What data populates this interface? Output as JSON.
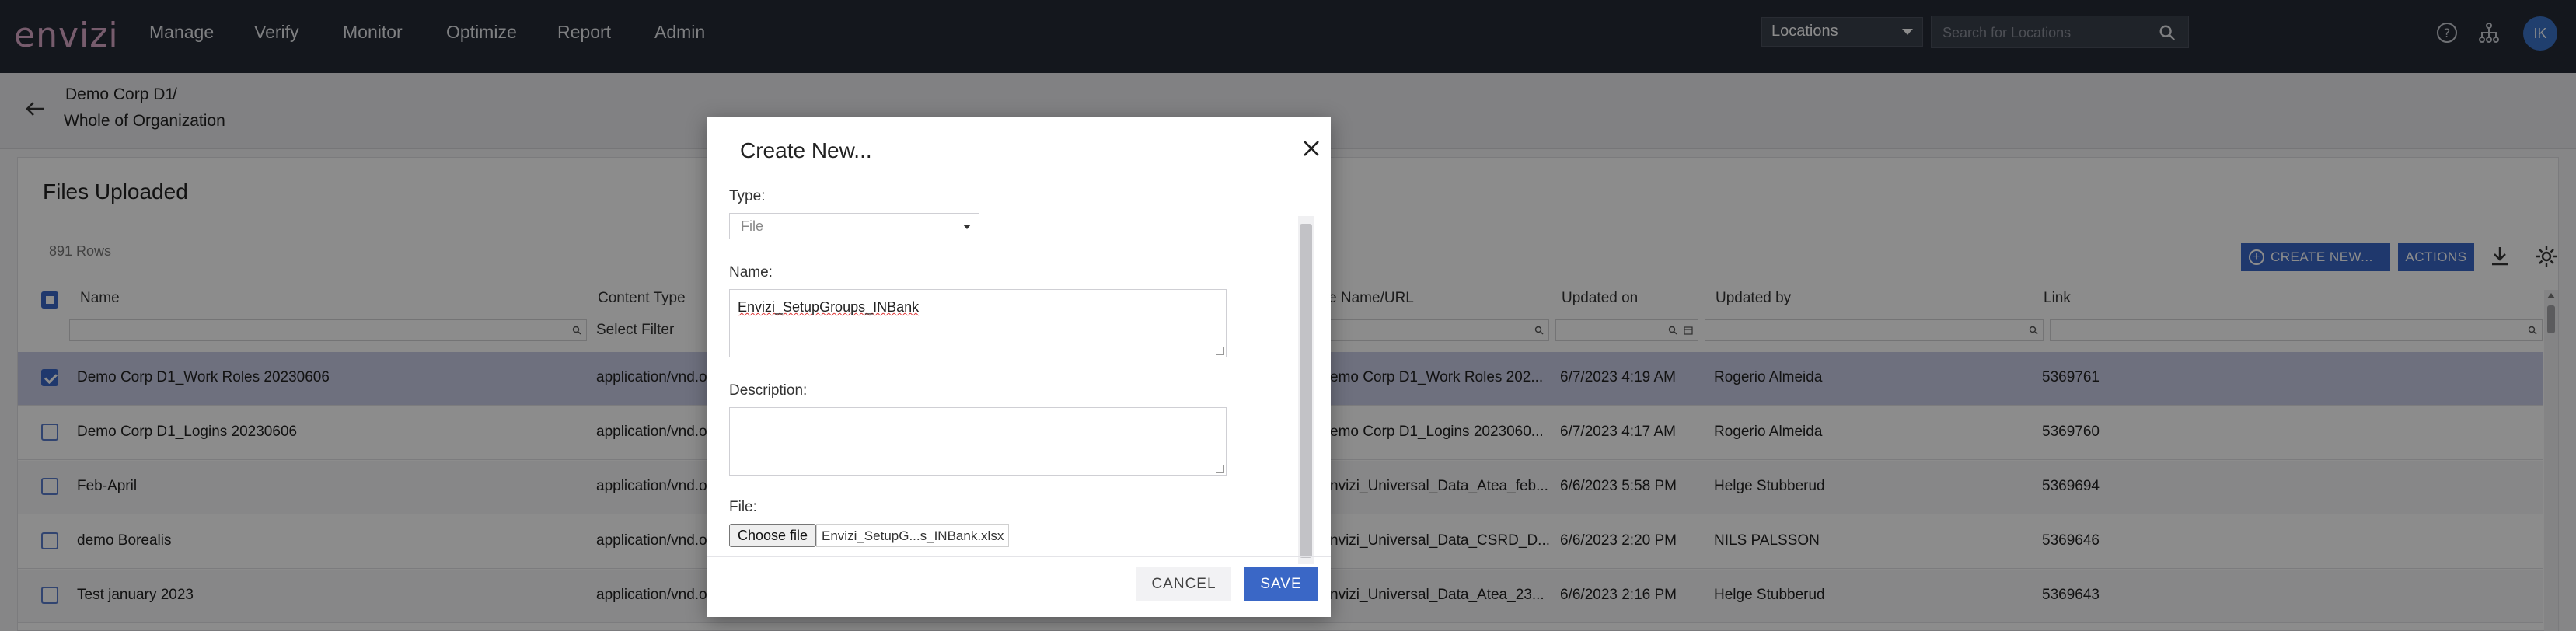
{
  "app": {
    "logo": "envizi"
  },
  "nav": {
    "items": [
      "Manage",
      "Verify",
      "Monitor",
      "Optimize",
      "Report",
      "Admin"
    ]
  },
  "locations": {
    "selected": "Locations",
    "search_placeholder": "Search for Locations"
  },
  "user": {
    "initials": "IK"
  },
  "breadcrumb": {
    "parent": "Demo Corp D1",
    "separator": "/",
    "current": "Whole of Organization"
  },
  "panel": {
    "title": "Files Uploaded",
    "row_count": "891 Rows",
    "create_label": "CREATE NEW...",
    "actions_label": "ACTIONS"
  },
  "table": {
    "columns": [
      "Name",
      "Content Type",
      "File Name/URL",
      "Updated on",
      "Updated by",
      "Link"
    ],
    "content_type_filter": "Select Filter",
    "rows": [
      {
        "name": "Demo Corp D1_Work Roles 20230606",
        "content_type": "application/vnd.op",
        "file": "emo Corp D1_Work Roles 202...",
        "updated_on": "6/7/2023 4:19 AM",
        "updated_by": "Rogerio Almeida",
        "link": "5369761",
        "checked": true
      },
      {
        "name": "Demo Corp D1_Logins 20230606",
        "content_type": "application/vnd.op",
        "file": "emo Corp D1_Logins 2023060...",
        "updated_on": "6/7/2023 4:17 AM",
        "updated_by": "Rogerio Almeida",
        "link": "5369760",
        "checked": false
      },
      {
        "name": "Feb-April",
        "content_type": "application/vnd.op",
        "file": "nvizi_Universal_Data_Atea_feb...",
        "updated_on": "6/6/2023 5:58 PM",
        "updated_by": "Helge Stubberud",
        "link": "5369694",
        "checked": false
      },
      {
        "name": "demo Borealis",
        "content_type": "application/vnd.op",
        "file": "nvizi_Universal_Data_CSRD_D...",
        "updated_on": "6/6/2023 2:20 PM",
        "updated_by": "NILS PALSSON",
        "link": "5369646",
        "checked": false
      },
      {
        "name": "Test january 2023",
        "content_type": "application/vnd.op",
        "file": "nvizi_Universal_Data_Atea_23...",
        "updated_on": "6/6/2023 2:16 PM",
        "updated_by": "Helge Stubberud",
        "link": "5369643",
        "checked": false
      }
    ]
  },
  "dialog": {
    "title": "Create New...",
    "type_label": "Type:",
    "type_value": "File",
    "name_label": "Name:",
    "name_value": "Envizi_SetupGroups_INBank",
    "description_label": "Description:",
    "description_value": "",
    "file_label": "File:",
    "choose_file_label": "Choose file",
    "file_name": "Envizi_SetupG...s_INBank.xlsx",
    "cancel_label": "CANCEL",
    "save_label": "SAVE"
  },
  "colors": {
    "nav_bg": "#262b36",
    "accent": "#3a67c6",
    "selected_row": "#c9cde6",
    "logo": "#d9a8c6"
  }
}
